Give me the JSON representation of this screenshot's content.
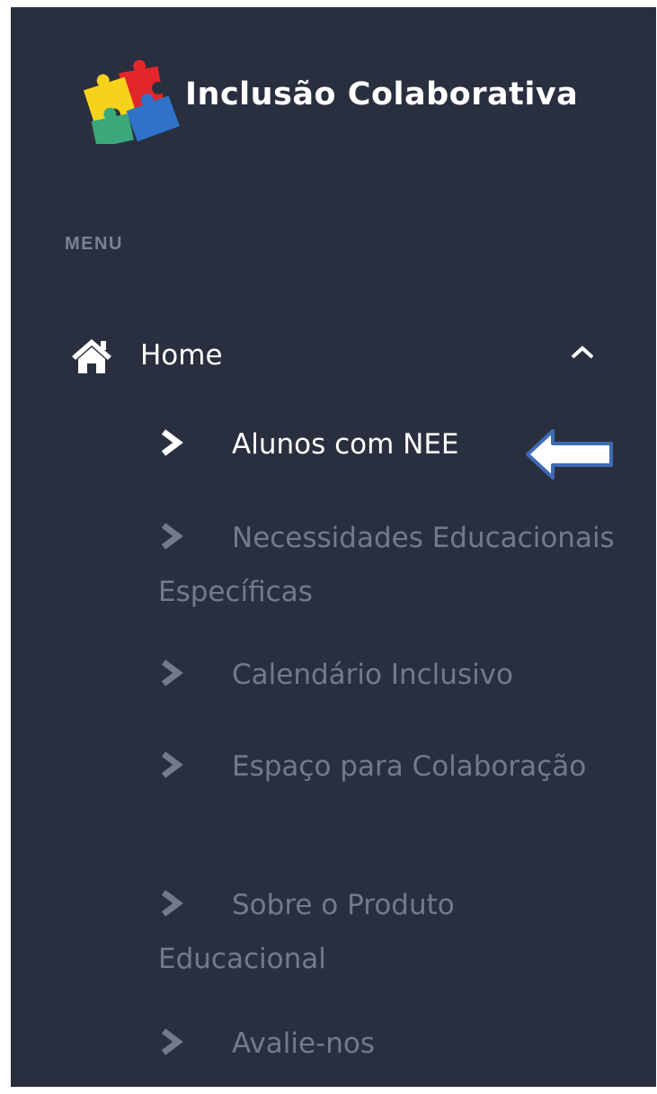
{
  "brand": {
    "title": "Inclusão Colaborativa",
    "logo": "puzzle-pieces-logo"
  },
  "menu": {
    "heading": "MENU",
    "home": {
      "label": "Home",
      "icon": "home-icon",
      "expanded": true
    },
    "items": [
      {
        "label": "Alunos com NEE",
        "active": true
      },
      {
        "label": "Necessidades Educacionais Específicas",
        "active": false
      },
      {
        "label": "Calendário Inclusivo",
        "active": false
      },
      {
        "label": "Espaço para Colaboração",
        "active": false
      },
      {
        "label": "Sobre o Produto Educacional",
        "active": false
      },
      {
        "label": "Avalie-nos",
        "active": false
      }
    ]
  },
  "colors": {
    "sidebar_bg": "#2a2f3f",
    "active_text": "#ffffff",
    "inactive_text": "#737a89",
    "annotation_arrow": "#3d6bb3"
  },
  "annotation": {
    "icon": "arrow-left-annotation"
  }
}
